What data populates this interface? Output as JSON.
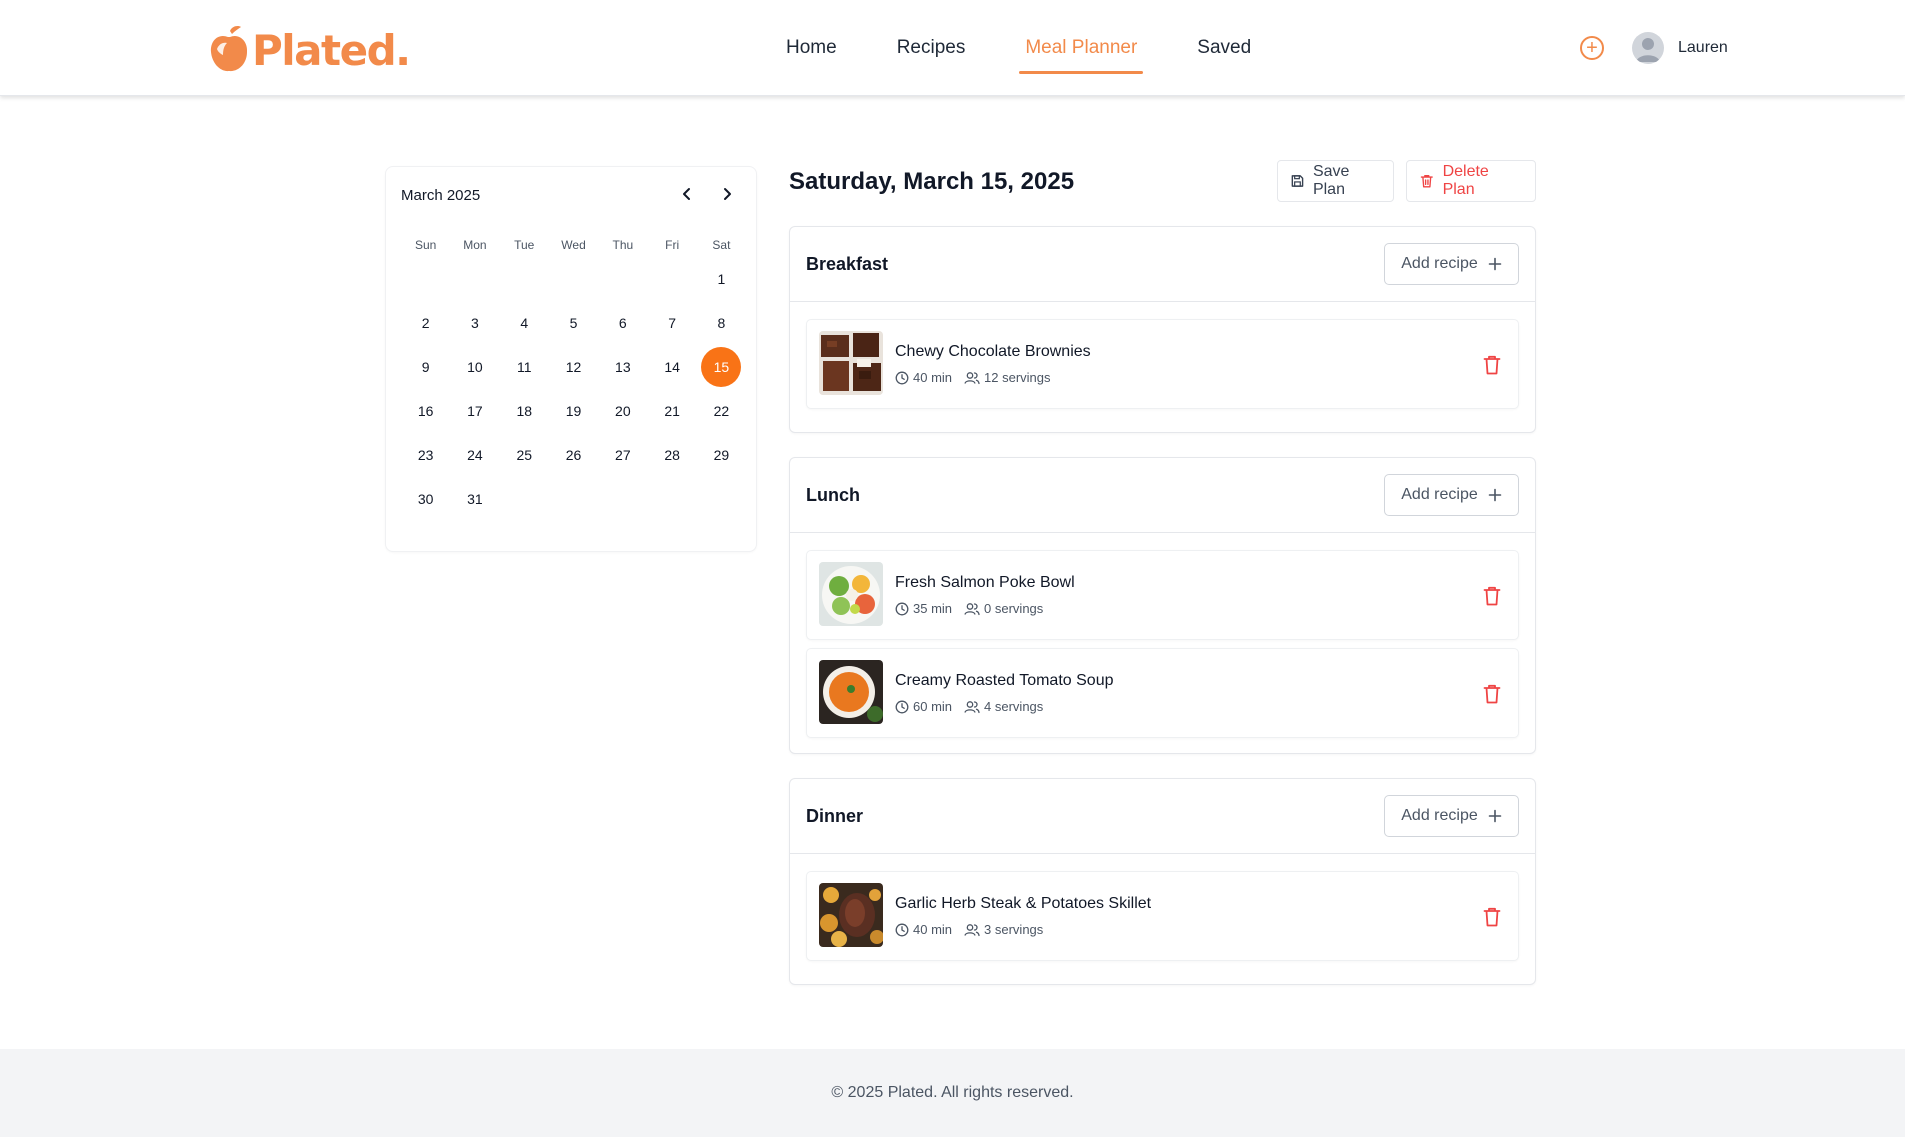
{
  "brand": {
    "name": "Plated.",
    "color": "#f28a4a"
  },
  "nav": {
    "items": [
      "Home",
      "Recipes",
      "Meal Planner",
      "Saved"
    ],
    "active": "Meal Planner"
  },
  "user": {
    "name": "Lauren"
  },
  "calendar": {
    "month_label": "March 2025",
    "weekdays": [
      "Sun",
      "Mon",
      "Tue",
      "Wed",
      "Thu",
      "Fri",
      "Sat"
    ],
    "first_weekday_index": 6,
    "days_in_month": 31,
    "selected_day": 15
  },
  "planner": {
    "date_title": "Saturday, March 15, 2025",
    "save_label": "Save Plan",
    "delete_label": "Delete Plan",
    "add_recipe_label": "Add recipe",
    "meals": [
      {
        "name": "Breakfast",
        "recipes": [
          {
            "title": "Chewy Chocolate Brownies",
            "time": "40 min",
            "servings": "12 servings",
            "image": "brownies"
          }
        ]
      },
      {
        "name": "Lunch",
        "recipes": [
          {
            "title": "Fresh Salmon Poke Bowl",
            "time": "35 min",
            "servings": "0 servings",
            "image": "poke-bowl"
          },
          {
            "title": "Creamy Roasted Tomato Soup",
            "time": "60 min",
            "servings": "4 servings",
            "image": "tomato-soup"
          }
        ]
      },
      {
        "name": "Dinner",
        "recipes": [
          {
            "title": "Garlic Herb Steak & Potatoes Skillet",
            "time": "40 min",
            "servings": "3 servings",
            "image": "steak-skillet"
          }
        ]
      }
    ]
  },
  "footer": {
    "text": "© 2025 Plated. All rights reserved."
  },
  "colors": {
    "accent": "#f97316",
    "danger": "#ef4444"
  }
}
